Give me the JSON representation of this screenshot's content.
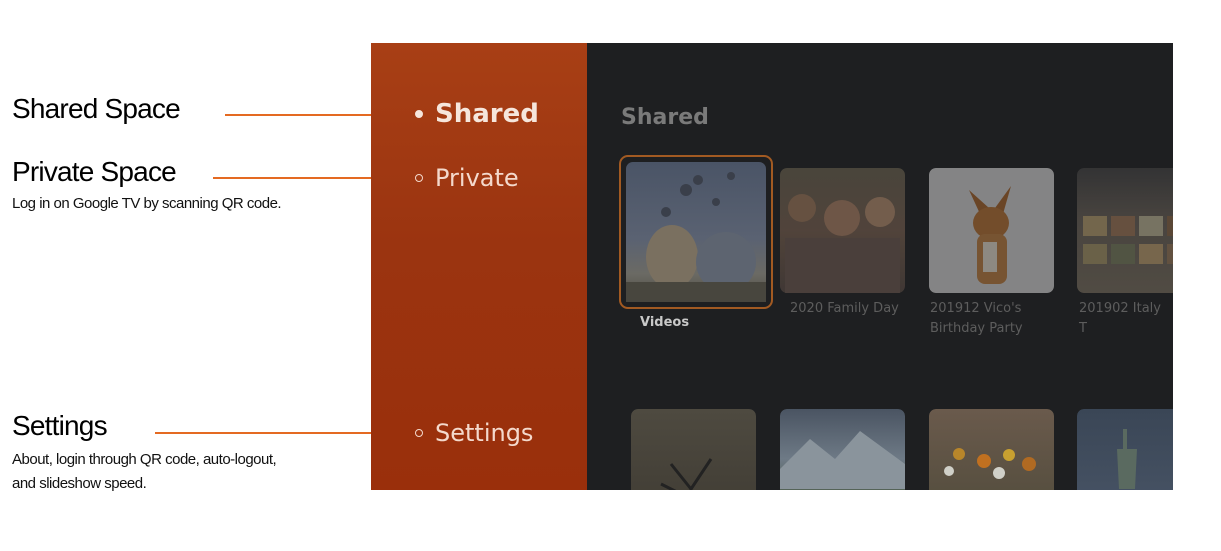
{
  "annotations": {
    "shared": {
      "title": "Shared Space"
    },
    "private": {
      "title": "Private Space",
      "desc": "Log in on Google TV by scanning QR code."
    },
    "settings": {
      "title": "Settings",
      "desc_line1": "About, login through QR code, auto-logout,",
      "desc_line2": "and slideshow speed."
    }
  },
  "colors": {
    "accent": "#e46a22",
    "sidebar": "#a03812",
    "background": "#1e1f21"
  },
  "sidebar": {
    "items": [
      {
        "label": "Shared",
        "active": true
      },
      {
        "label": "Private",
        "active": false
      },
      {
        "label": "Settings",
        "active": false
      }
    ]
  },
  "main": {
    "title": "Shared",
    "row1": [
      {
        "label": "Videos",
        "icon": "hot-air-balloons-photo"
      },
      {
        "label": "2020 Family Day",
        "icon": "family-photo"
      },
      {
        "label": "201912 Vico's Birthday Party",
        "label_line1": "201912 Vico's",
        "label_line2": "Birthday Party",
        "icon": "dog-photo"
      },
      {
        "label": "201902 Italy T",
        "icon": "gelato-photo"
      }
    ],
    "row2": [
      {
        "icon": "tree-silhouette-photo"
      },
      {
        "icon": "mountain-photo"
      },
      {
        "icon": "flowers-photo"
      },
      {
        "icon": "statue-of-liberty-photo"
      }
    ]
  }
}
